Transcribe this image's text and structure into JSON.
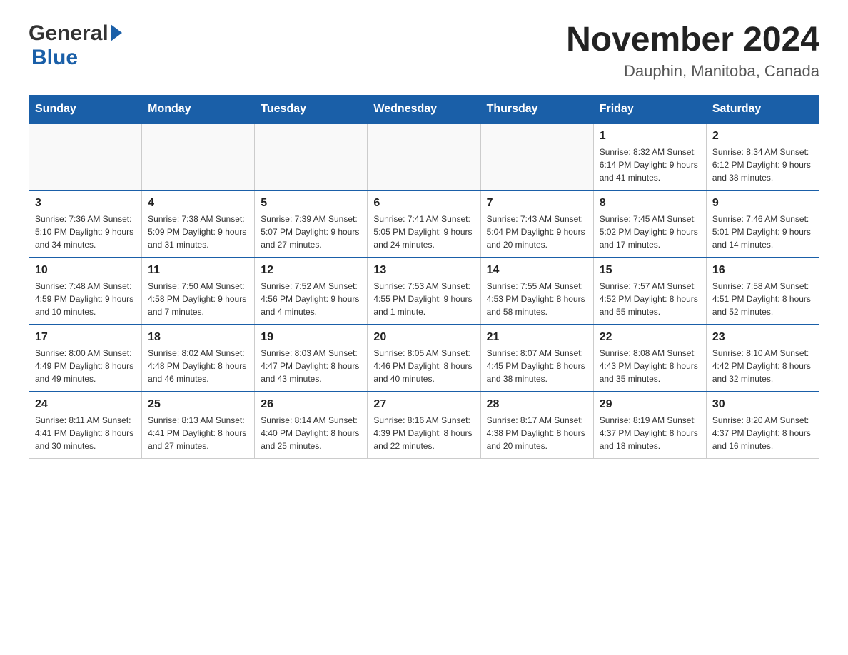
{
  "header": {
    "logo_general": "General",
    "logo_blue": "Blue",
    "month_title": "November 2024",
    "location": "Dauphin, Manitoba, Canada"
  },
  "calendar": {
    "days_of_week": [
      "Sunday",
      "Monday",
      "Tuesday",
      "Wednesday",
      "Thursday",
      "Friday",
      "Saturday"
    ],
    "weeks": [
      {
        "days": [
          {
            "number": "",
            "info": ""
          },
          {
            "number": "",
            "info": ""
          },
          {
            "number": "",
            "info": ""
          },
          {
            "number": "",
            "info": ""
          },
          {
            "number": "",
            "info": ""
          },
          {
            "number": "1",
            "info": "Sunrise: 8:32 AM\nSunset: 6:14 PM\nDaylight: 9 hours and 41 minutes."
          },
          {
            "number": "2",
            "info": "Sunrise: 8:34 AM\nSunset: 6:12 PM\nDaylight: 9 hours and 38 minutes."
          }
        ]
      },
      {
        "days": [
          {
            "number": "3",
            "info": "Sunrise: 7:36 AM\nSunset: 5:10 PM\nDaylight: 9 hours and 34 minutes."
          },
          {
            "number": "4",
            "info": "Sunrise: 7:38 AM\nSunset: 5:09 PM\nDaylight: 9 hours and 31 minutes."
          },
          {
            "number": "5",
            "info": "Sunrise: 7:39 AM\nSunset: 5:07 PM\nDaylight: 9 hours and 27 minutes."
          },
          {
            "number": "6",
            "info": "Sunrise: 7:41 AM\nSunset: 5:05 PM\nDaylight: 9 hours and 24 minutes."
          },
          {
            "number": "7",
            "info": "Sunrise: 7:43 AM\nSunset: 5:04 PM\nDaylight: 9 hours and 20 minutes."
          },
          {
            "number": "8",
            "info": "Sunrise: 7:45 AM\nSunset: 5:02 PM\nDaylight: 9 hours and 17 minutes."
          },
          {
            "number": "9",
            "info": "Sunrise: 7:46 AM\nSunset: 5:01 PM\nDaylight: 9 hours and 14 minutes."
          }
        ]
      },
      {
        "days": [
          {
            "number": "10",
            "info": "Sunrise: 7:48 AM\nSunset: 4:59 PM\nDaylight: 9 hours and 10 minutes."
          },
          {
            "number": "11",
            "info": "Sunrise: 7:50 AM\nSunset: 4:58 PM\nDaylight: 9 hours and 7 minutes."
          },
          {
            "number": "12",
            "info": "Sunrise: 7:52 AM\nSunset: 4:56 PM\nDaylight: 9 hours and 4 minutes."
          },
          {
            "number": "13",
            "info": "Sunrise: 7:53 AM\nSunset: 4:55 PM\nDaylight: 9 hours and 1 minute."
          },
          {
            "number": "14",
            "info": "Sunrise: 7:55 AM\nSunset: 4:53 PM\nDaylight: 8 hours and 58 minutes."
          },
          {
            "number": "15",
            "info": "Sunrise: 7:57 AM\nSunset: 4:52 PM\nDaylight: 8 hours and 55 minutes."
          },
          {
            "number": "16",
            "info": "Sunrise: 7:58 AM\nSunset: 4:51 PM\nDaylight: 8 hours and 52 minutes."
          }
        ]
      },
      {
        "days": [
          {
            "number": "17",
            "info": "Sunrise: 8:00 AM\nSunset: 4:49 PM\nDaylight: 8 hours and 49 minutes."
          },
          {
            "number": "18",
            "info": "Sunrise: 8:02 AM\nSunset: 4:48 PM\nDaylight: 8 hours and 46 minutes."
          },
          {
            "number": "19",
            "info": "Sunrise: 8:03 AM\nSunset: 4:47 PM\nDaylight: 8 hours and 43 minutes."
          },
          {
            "number": "20",
            "info": "Sunrise: 8:05 AM\nSunset: 4:46 PM\nDaylight: 8 hours and 40 minutes."
          },
          {
            "number": "21",
            "info": "Sunrise: 8:07 AM\nSunset: 4:45 PM\nDaylight: 8 hours and 38 minutes."
          },
          {
            "number": "22",
            "info": "Sunrise: 8:08 AM\nSunset: 4:43 PM\nDaylight: 8 hours and 35 minutes."
          },
          {
            "number": "23",
            "info": "Sunrise: 8:10 AM\nSunset: 4:42 PM\nDaylight: 8 hours and 32 minutes."
          }
        ]
      },
      {
        "days": [
          {
            "number": "24",
            "info": "Sunrise: 8:11 AM\nSunset: 4:41 PM\nDaylight: 8 hours and 30 minutes."
          },
          {
            "number": "25",
            "info": "Sunrise: 8:13 AM\nSunset: 4:41 PM\nDaylight: 8 hours and 27 minutes."
          },
          {
            "number": "26",
            "info": "Sunrise: 8:14 AM\nSunset: 4:40 PM\nDaylight: 8 hours and 25 minutes."
          },
          {
            "number": "27",
            "info": "Sunrise: 8:16 AM\nSunset: 4:39 PM\nDaylight: 8 hours and 22 minutes."
          },
          {
            "number": "28",
            "info": "Sunrise: 8:17 AM\nSunset: 4:38 PM\nDaylight: 8 hours and 20 minutes."
          },
          {
            "number": "29",
            "info": "Sunrise: 8:19 AM\nSunset: 4:37 PM\nDaylight: 8 hours and 18 minutes."
          },
          {
            "number": "30",
            "info": "Sunrise: 8:20 AM\nSunset: 4:37 PM\nDaylight: 8 hours and 16 minutes."
          }
        ]
      }
    ]
  }
}
